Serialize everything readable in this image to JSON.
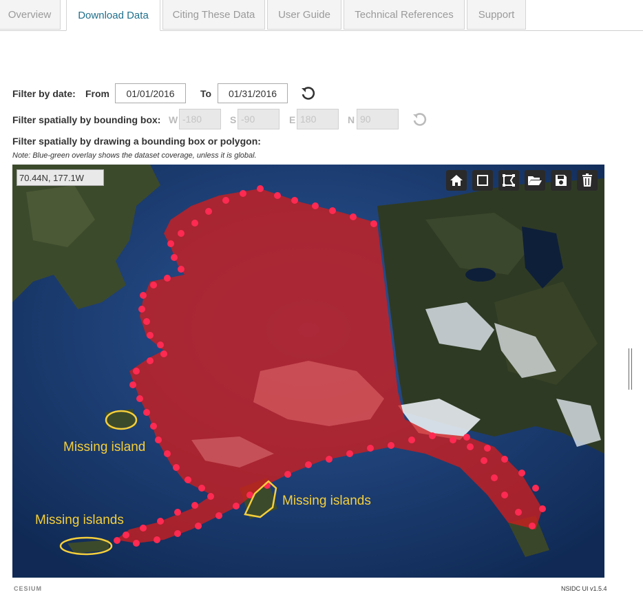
{
  "tabs": [
    {
      "label": "Overview",
      "active": false
    },
    {
      "label": "Download Data",
      "active": true
    },
    {
      "label": "Citing These Data",
      "active": false
    },
    {
      "label": "User Guide",
      "active": false
    },
    {
      "label": "Technical References",
      "active": false
    },
    {
      "label": "Support",
      "active": false
    }
  ],
  "date_filter": {
    "label": "Filter by date:",
    "from_label": "From",
    "from_value": "01/01/2016",
    "to_label": "To",
    "to_value": "01/31/2016",
    "reset_icon": "reset-icon"
  },
  "bbox_filter": {
    "label": "Filter spatially by bounding box:",
    "w_label": "W",
    "w_placeholder": "-180",
    "s_label": "S",
    "s_placeholder": "-90",
    "e_label": "E",
    "e_placeholder": "180",
    "n_label": "N",
    "n_placeholder": "90",
    "reset_icon": "reset-icon"
  },
  "draw_filter": {
    "label": "Filter spatially by drawing a bounding box or polygon:",
    "note": "Note: Blue-green overlay shows the dataset coverage, unless it is global."
  },
  "map": {
    "coordinate_readout": "70.44N, 177.1W",
    "toolbar": [
      "home-icon",
      "rectangle-icon",
      "polygon-icon",
      "folder-open-icon",
      "save-icon",
      "trash-icon"
    ],
    "annotations": {
      "missing_island": "Missing island",
      "missing_islands_right": "Missing islands",
      "missing_islands_left": "Missing islands"
    },
    "colors": {
      "overlay": "#d01e1e",
      "vertex": "#ff2a52",
      "annotation": "#f5cf3b",
      "ocean": "#1a3f73"
    }
  },
  "footer": {
    "cesium_logo": "CESIUM",
    "version": "NSIDC UI v1.5.4"
  }
}
